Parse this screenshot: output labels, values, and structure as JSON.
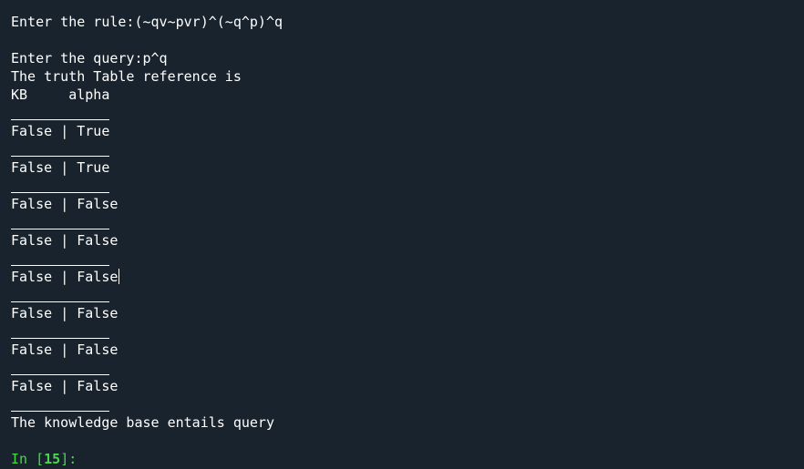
{
  "console": {
    "rule_prompt": "Enter the rule:",
    "rule_value": "(~qv~pvr)^(~q^p)^q",
    "query_prompt": "Enter the query:",
    "query_value": "p^q",
    "truth_table_heading": "The truth Table reference is",
    "column_kb": "KB",
    "column_alpha": "alpha",
    "rows": [
      {
        "kb": "False",
        "alpha": "True"
      },
      {
        "kb": "False",
        "alpha": "True"
      },
      {
        "kb": "False",
        "alpha": "False"
      },
      {
        "kb": "False",
        "alpha": "False"
      },
      {
        "kb": "False",
        "alpha": "False"
      },
      {
        "kb": "False",
        "alpha": "False"
      },
      {
        "kb": "False",
        "alpha": "False"
      },
      {
        "kb": "False",
        "alpha": "False"
      }
    ],
    "separator": "|",
    "result": "The knowledge base entails query",
    "input_prompt_label": "In [",
    "input_prompt_number": "15",
    "input_prompt_suffix": "]:"
  },
  "colors": {
    "background": "#19232d",
    "text": "#ffffff",
    "prompt": "#4ad84a"
  }
}
